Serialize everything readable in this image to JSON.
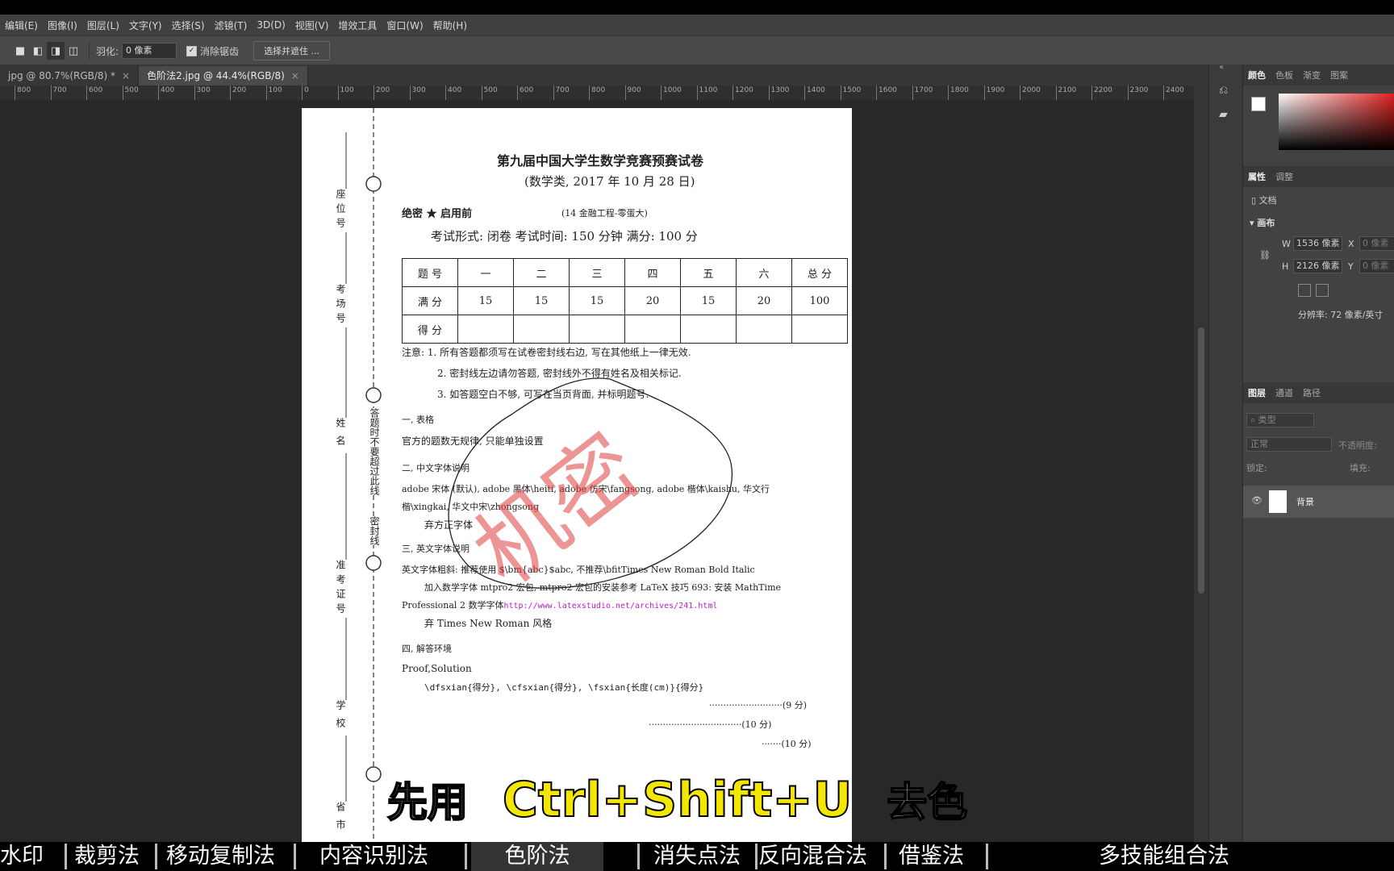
{
  "menu": [
    "编辑(E)",
    "图像(I)",
    "图层(L)",
    "文字(Y)",
    "选择(S)",
    "滤镜(T)",
    "3D(D)",
    "视图(V)",
    "增效工具",
    "窗口(W)",
    "帮助(H)"
  ],
  "options": {
    "feather_label": "羽化:",
    "feather_value": "0 像素",
    "antialias_label": "消除锯齿",
    "select_mask_button": "选择并遮住 ..."
  },
  "tabs": [
    {
      "label": "jpg @ 80.7%(RGB/8) *"
    },
    {
      "label": "色阶法2.jpg @ 44.4%(RGB/8)"
    }
  ],
  "ruler_h": [
    "800",
    "700",
    "600",
    "500",
    "400",
    "300",
    "200",
    "100",
    "0",
    "100",
    "200",
    "300",
    "400",
    "500",
    "600",
    "700",
    "800",
    "900",
    "1000",
    "1100",
    "1200",
    "1300",
    "1400",
    "1500",
    "1600",
    "1700",
    "1800",
    "1900",
    "2000",
    "2100",
    "2200",
    "2300",
    "2400"
  ],
  "panels": {
    "color_tabs": [
      "颜色",
      "色板",
      "渐变",
      "图案"
    ],
    "props_tabs": [
      "属性",
      "调整"
    ],
    "doc_label": "文档",
    "canvas_label": "画布",
    "w_label": "W",
    "w_value": "1536 像素",
    "h_label": "H",
    "h_value": "2126 像素",
    "x_label": "X",
    "x_value": "0 像素",
    "y_label": "Y",
    "y_value": "0 像素",
    "resolution": "分辨率: 72 像素/英寸",
    "layers_tabs": [
      "图层",
      "通道",
      "路径"
    ],
    "layer_search": "类型",
    "blend_mode": "正常",
    "opacity_label": "不透明度:",
    "lock_label": "锁定:",
    "fill_label": "填充:",
    "layer_name": "背景"
  },
  "doc": {
    "title": "第九届中国大学生数学竞赛预赛试卷",
    "subtitle": "(数学类, 2017 年 10 月 28 日)",
    "secret": "绝密 ★ 启用前",
    "note_top": "(14 金融工程-零蛋大)",
    "exam_line": "考试形式: 闭卷   考试时间: 150 分钟   满分: 100 分",
    "table": {
      "header": [
        "题 号",
        "一",
        "二",
        "三",
        "四",
        "五",
        "六",
        "总 分"
      ],
      "row1": [
        "满 分",
        "15",
        "15",
        "15",
        "20",
        "15",
        "20",
        "100"
      ],
      "row2": [
        "得 分",
        "",
        "",
        "",
        "",
        "",
        "",
        ""
      ]
    },
    "notes": [
      "注意: 1. 所有答题都须写在试卷密封线右边, 写在其他纸上一律无效.",
      "2. 密封线左边请勿答题, 密封线外不得有姓名及相关标记.",
      "3. 如答题空白不够, 可写在当页背面, 并标明题号."
    ],
    "sec1": "一, 表格",
    "sec1_text": "官方的题数无规律, 只能单独设置",
    "sec2": "二, 中文字体说明",
    "sec2_text1": "adobe 宋体 (默认), adobe 黑体\\heiti, adobe 仿宋\\fangsong, adobe 楷体\\kaishu, 华文行",
    "sec2_text2": "楷\\xingkai, 华文中宋\\zhongsong",
    "sec2_text3": "弃方正字体",
    "sec3": "三, 英文字体说明",
    "sec3_text1": "英文字体粗斜: 推荐使用 $\\bm{abc}$abc, 不推荐\\bfitTimes New Roman Bold Italic",
    "sec3_text2": "加入数学字体 mtpro2 宏包, mtpro2 宏包的安装参考 LaTeX 技巧 693: 安装 MathTime",
    "sec3_text3": "Professional 2 数学字体",
    "sec3_link": "http://www.latexstudio.net/archives/241.html",
    "sec3_text4": "弃 Times New Roman 风格",
    "sec4": "四, 解答环境",
    "sec4_text1": "Proof,Solution",
    "sec4_text2": "\\dfsxian{得分}, \\cfsxian{得分}, \\fsxian{长度(cm)}{得分}",
    "score1": "··························(9 分)",
    "score2": "·································(10 分)",
    "score3": "·······(10 分)",
    "side_labels": [
      "座位号",
      "考场号",
      "姓名",
      "准考证号",
      "学校",
      "省市"
    ],
    "side_vertical": "答题时不要超过此线",
    "side_seal": "密封线",
    "stamp": "机密"
  },
  "subtitle": {
    "pre": "先用",
    "keys": "Ctrl+Shift+U",
    "post": "去色"
  },
  "bottom": [
    "水印",
    "裁剪法",
    "移动复制法",
    "内容识别法",
    "色阶法",
    "消失点法",
    "反向混合法",
    "借鉴法",
    "多技能组合法"
  ],
  "colors": {
    "accent_yellow": "#f3e600",
    "stamp_red": "#e04040",
    "link_magenta": "#c020c0"
  }
}
